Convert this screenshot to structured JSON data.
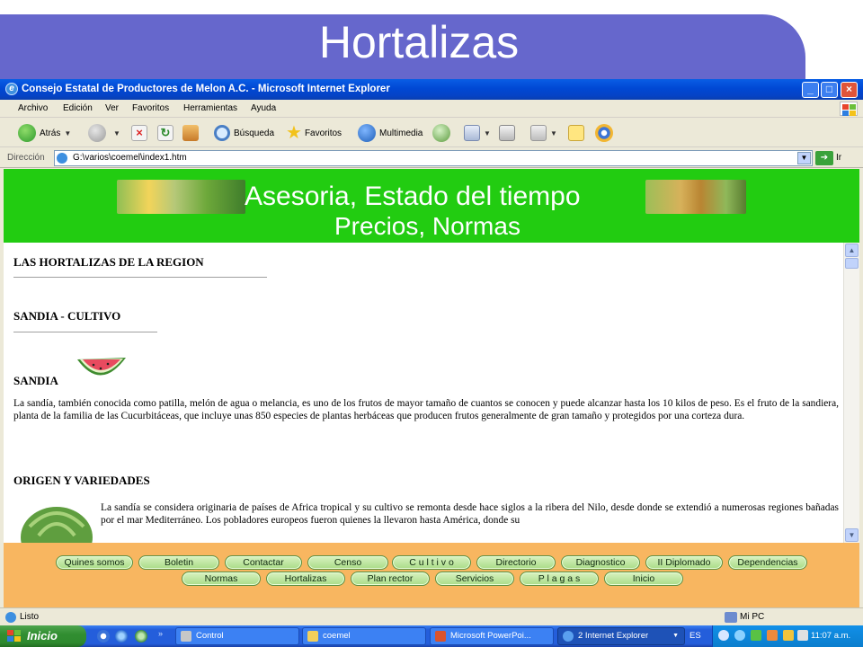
{
  "slide": {
    "title": "Hortalizas"
  },
  "window": {
    "title": "Consejo Estatal de Productores de Melon A.C. - Microsoft Internet Explorer",
    "menu": [
      "Archivo",
      "Edición",
      "Ver",
      "Favoritos",
      "Herramientas",
      "Ayuda"
    ],
    "toolbar": {
      "back": "Atrás",
      "search": "Búsqueda",
      "favorites": "Favoritos",
      "media": "Multimedia"
    },
    "address": {
      "label": "Dirección",
      "value": "G:\\varios\\coemel\\index1.htm",
      "go": "Ir"
    },
    "status": {
      "text": "Listo",
      "zone": "Mi PC"
    }
  },
  "page": {
    "banner": {
      "line1": "Asesoria,  Estado del tiempo",
      "line2": "Precios, Normas"
    },
    "headings": {
      "hortalizas": "LAS HORTALIZAS DE LA REGION",
      "cultivo": "SANDIA - CULTIVO",
      "sandia": "SANDIA",
      "origen": "ORIGEN Y VARIEDADES"
    },
    "paragraphs": {
      "sandia": "La sandía, también conocida como patilla, melón de agua o melancia, es uno de los frutos de mayor tamaño de cuantos se conocen y puede alcanzar hasta los 10 kilos de peso. Es el fruto de la sandiera, planta de la familia de las Cucurbitáceas, que incluye unas 850 especies de plantas herbáceas que producen frutos generalmente de gran tamaño y protegidos por una corteza dura.",
      "origen": "La sandía se considera originaria de países de Africa tropical y su cultivo se remonta desde hace siglos a la ribera del Nilo, desde donde se extendió a numerosas regiones bañadas por el mar Mediterráneo. Los pobladores europeos fueron quienes la llevaron hasta América, donde su"
    },
    "nav_row1": [
      "Quines somos",
      "Boletin",
      "Contactar",
      "Censo",
      "C u l t i v o",
      "Directorio",
      "Diagnostico",
      "II Diplomado",
      "Dependencias"
    ],
    "nav_row2": [
      "Normas",
      "Hortalizas",
      "Plan rector",
      "Servicios",
      "P l a g a s",
      "Inicio"
    ]
  },
  "taskbar": {
    "start": "Inicio",
    "tasks": [
      "Control",
      "coemel",
      "Microsoft PowerPoi...",
      "2 Internet Explorer"
    ],
    "lang": "ES",
    "clock": "11:07 a.m."
  },
  "colors": {
    "slide_banner": "#6667cc",
    "green_banner": "#22cc11",
    "nav_bg": "#f8b660",
    "xp_blue": "#245edb"
  }
}
